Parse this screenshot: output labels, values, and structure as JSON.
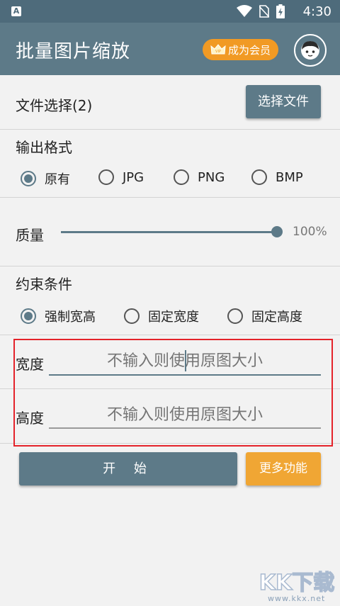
{
  "statusbar": {
    "app_badge": "A",
    "time": "4:30"
  },
  "appbar": {
    "title": "批量图片缩放",
    "vip_label": "成为会员",
    "vip_badge": "VIP"
  },
  "file_select": {
    "label": "文件选择(2)",
    "button": "选择文件"
  },
  "output_format": {
    "heading": "输出格式",
    "options": [
      "原有",
      "JPG",
      "PNG",
      "BMP"
    ],
    "selected": "原有"
  },
  "quality": {
    "label": "质量",
    "value": 1.0,
    "value_text": "100%"
  },
  "constraint": {
    "heading": "约束条件",
    "options": [
      "强制宽高",
      "固定宽度",
      "固定高度"
    ],
    "selected": "强制宽高"
  },
  "width": {
    "label": "宽度",
    "placeholder": "不输入则使用原图大小"
  },
  "height": {
    "label": "高度",
    "placeholder": "不输入则使用原图大小"
  },
  "actions": {
    "start": "开 始",
    "more": "更多功能"
  },
  "watermark": {
    "logo": "KK下载",
    "url": "www.kkx.net"
  },
  "colors": {
    "primary": "#5d7a88",
    "statusbar": "#4e6b7b",
    "accent": "#f19a24",
    "more_button": "#f0a634",
    "highlight_box": "#e4232a"
  }
}
